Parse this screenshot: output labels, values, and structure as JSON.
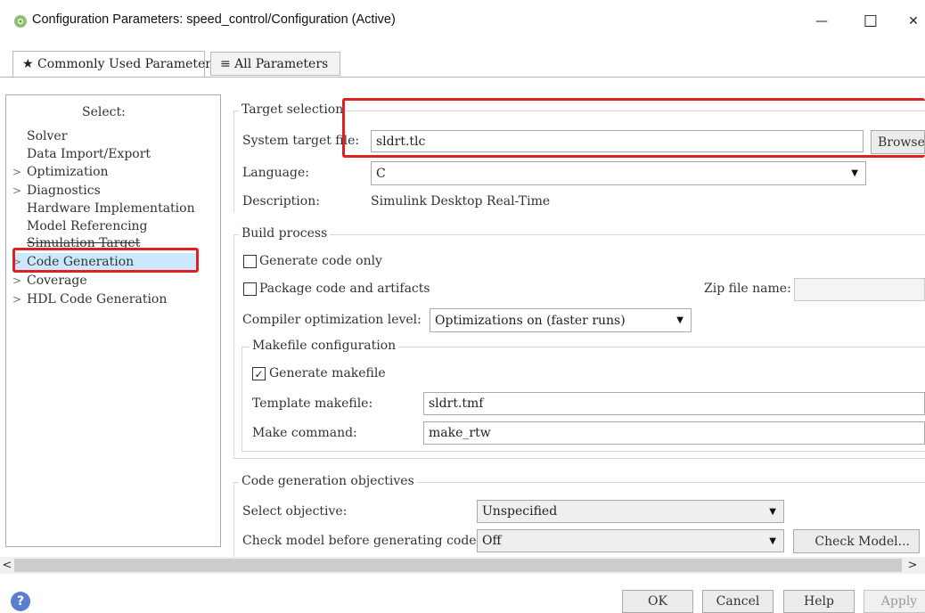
{
  "window": {
    "title": "Configuration Parameters: speed_control/Configuration (Active)",
    "minimize": "—",
    "maximize": "☐",
    "close": "✕"
  },
  "tabs": [
    {
      "label": "★ Commonly Used Parameters",
      "active": true
    },
    {
      "label": "≡ All Parameters",
      "active": false
    }
  ],
  "sidebar": {
    "select_label": "Select:",
    "items": [
      {
        "label": "Solver",
        "expandable": false
      },
      {
        "label": "Data Import/Export",
        "expandable": false
      },
      {
        "label": "Optimization",
        "expandable": true
      },
      {
        "label": "Diagnostics",
        "expandable": true
      },
      {
        "label": "Hardware Implementation",
        "expandable": false
      },
      {
        "label": "Model Referencing",
        "expandable": false
      },
      {
        "label": "Simulation Target",
        "expandable": false
      },
      {
        "label": "Code Generation",
        "expandable": true,
        "selected": true
      },
      {
        "label": "Coverage",
        "expandable": true
      },
      {
        "label": "HDL Code Generation",
        "expandable": true
      }
    ],
    "chevron": ">"
  },
  "target_selection": {
    "legend": "Target selection",
    "system_target_label": "System target file:",
    "system_target_value": "sldrt.tlc",
    "browse_label": "Browse...",
    "language_label": "Language:",
    "language_value": "C",
    "description_label": "Description:",
    "description_value": "Simulink Desktop Real-Time"
  },
  "build_process": {
    "legend": "Build process",
    "generate_code_only_label": "Generate code only",
    "generate_code_only_checked": false,
    "package_code_label": "Package code and artifacts",
    "package_code_checked": false,
    "zip_file_label": "Zip file name:",
    "zip_file_value": "",
    "compiler_opt_label": "Compiler optimization level:",
    "compiler_opt_value": "Optimizations on (faster runs)",
    "makefile": {
      "legend": "Makefile configuration",
      "generate_makefile_label": "Generate makefile",
      "generate_makefile_checked": true,
      "template_label": "Template makefile:",
      "template_value": "sldrt.tmf",
      "make_command_label": "Make command:",
      "make_command_value": "make_rtw"
    }
  },
  "objectives": {
    "legend": "Code generation objectives",
    "select_objective_label": "Select objective:",
    "select_objective_value": "Unspecified",
    "check_model_label": "Check model before generating code:",
    "check_model_value": "Off",
    "check_model_button": "Check Model..."
  },
  "footer": {
    "help_icon_glyph": "?",
    "ok": "OK",
    "cancel": "Cancel",
    "help": "Help",
    "apply": "Apply"
  },
  "scroll": {
    "left": "<",
    "right": ">"
  },
  "colors": {
    "highlight": "#e02020",
    "selection": "#cce8ff"
  }
}
